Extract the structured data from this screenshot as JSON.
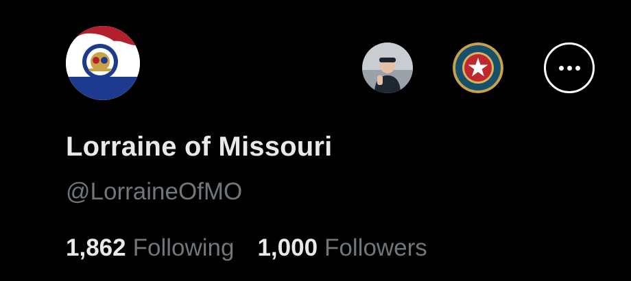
{
  "profile": {
    "display_name": "Lorraine of Missouri",
    "handle": "@LorraineOfMO",
    "avatar_icon": "missouri-flag-seal-icon"
  },
  "actions": {
    "person_icon": "person-avatar-icon",
    "badge_icon": "star-badge-icon",
    "more_icon": "more-options-icon"
  },
  "stats": {
    "following_count": "1,862",
    "following_label": "Following",
    "followers_count": "1,000",
    "followers_label": "Followers"
  },
  "colors": {
    "background": "#000000",
    "primary_text": "#e7e9ea",
    "secondary_text": "#71767b",
    "flag_red": "#b41f2e",
    "flag_blue": "#1d3a8f"
  }
}
